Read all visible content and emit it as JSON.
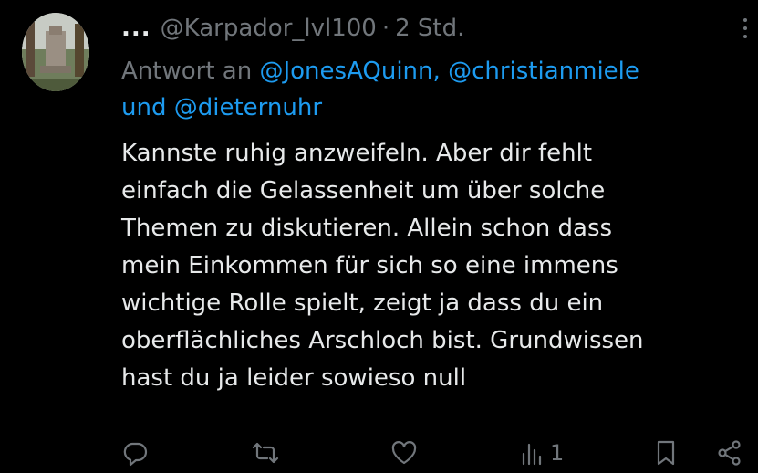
{
  "header": {
    "dots": "...",
    "handle": "@Karpador_lvl100",
    "separator": "·",
    "time": "2 Std."
  },
  "reply": {
    "prefix": "Antwort an",
    "mention1": "@JonesAQuinn,",
    "mention2": "@christianmiele",
    "conjunction": "und",
    "mention3": "@dieternuhr"
  },
  "body": {
    "lines": [
      "Kannste ruhig anzweifeln. Aber dir fehlt",
      "einfach die Gelassenheit um über solche",
      "Themen zu diskutieren. Allein schon dass",
      "mein Einkommen für sich so eine immens",
      "wichtige Rolle spielt, zeigt ja dass du ein",
      "oberflächliches Arschloch bist. Grundwissen",
      "hast du ja leider sowieso null"
    ]
  },
  "actions": {
    "views_count": "1",
    "icons": [
      "reply-icon",
      "repost-icon",
      "like-icon",
      "views-icon",
      "bookmark-icon",
      "share-icon"
    ]
  },
  "colors": {
    "background": "#000000",
    "text": "#e7e9ea",
    "muted": "#71767b",
    "link": "#1d9bf0"
  }
}
